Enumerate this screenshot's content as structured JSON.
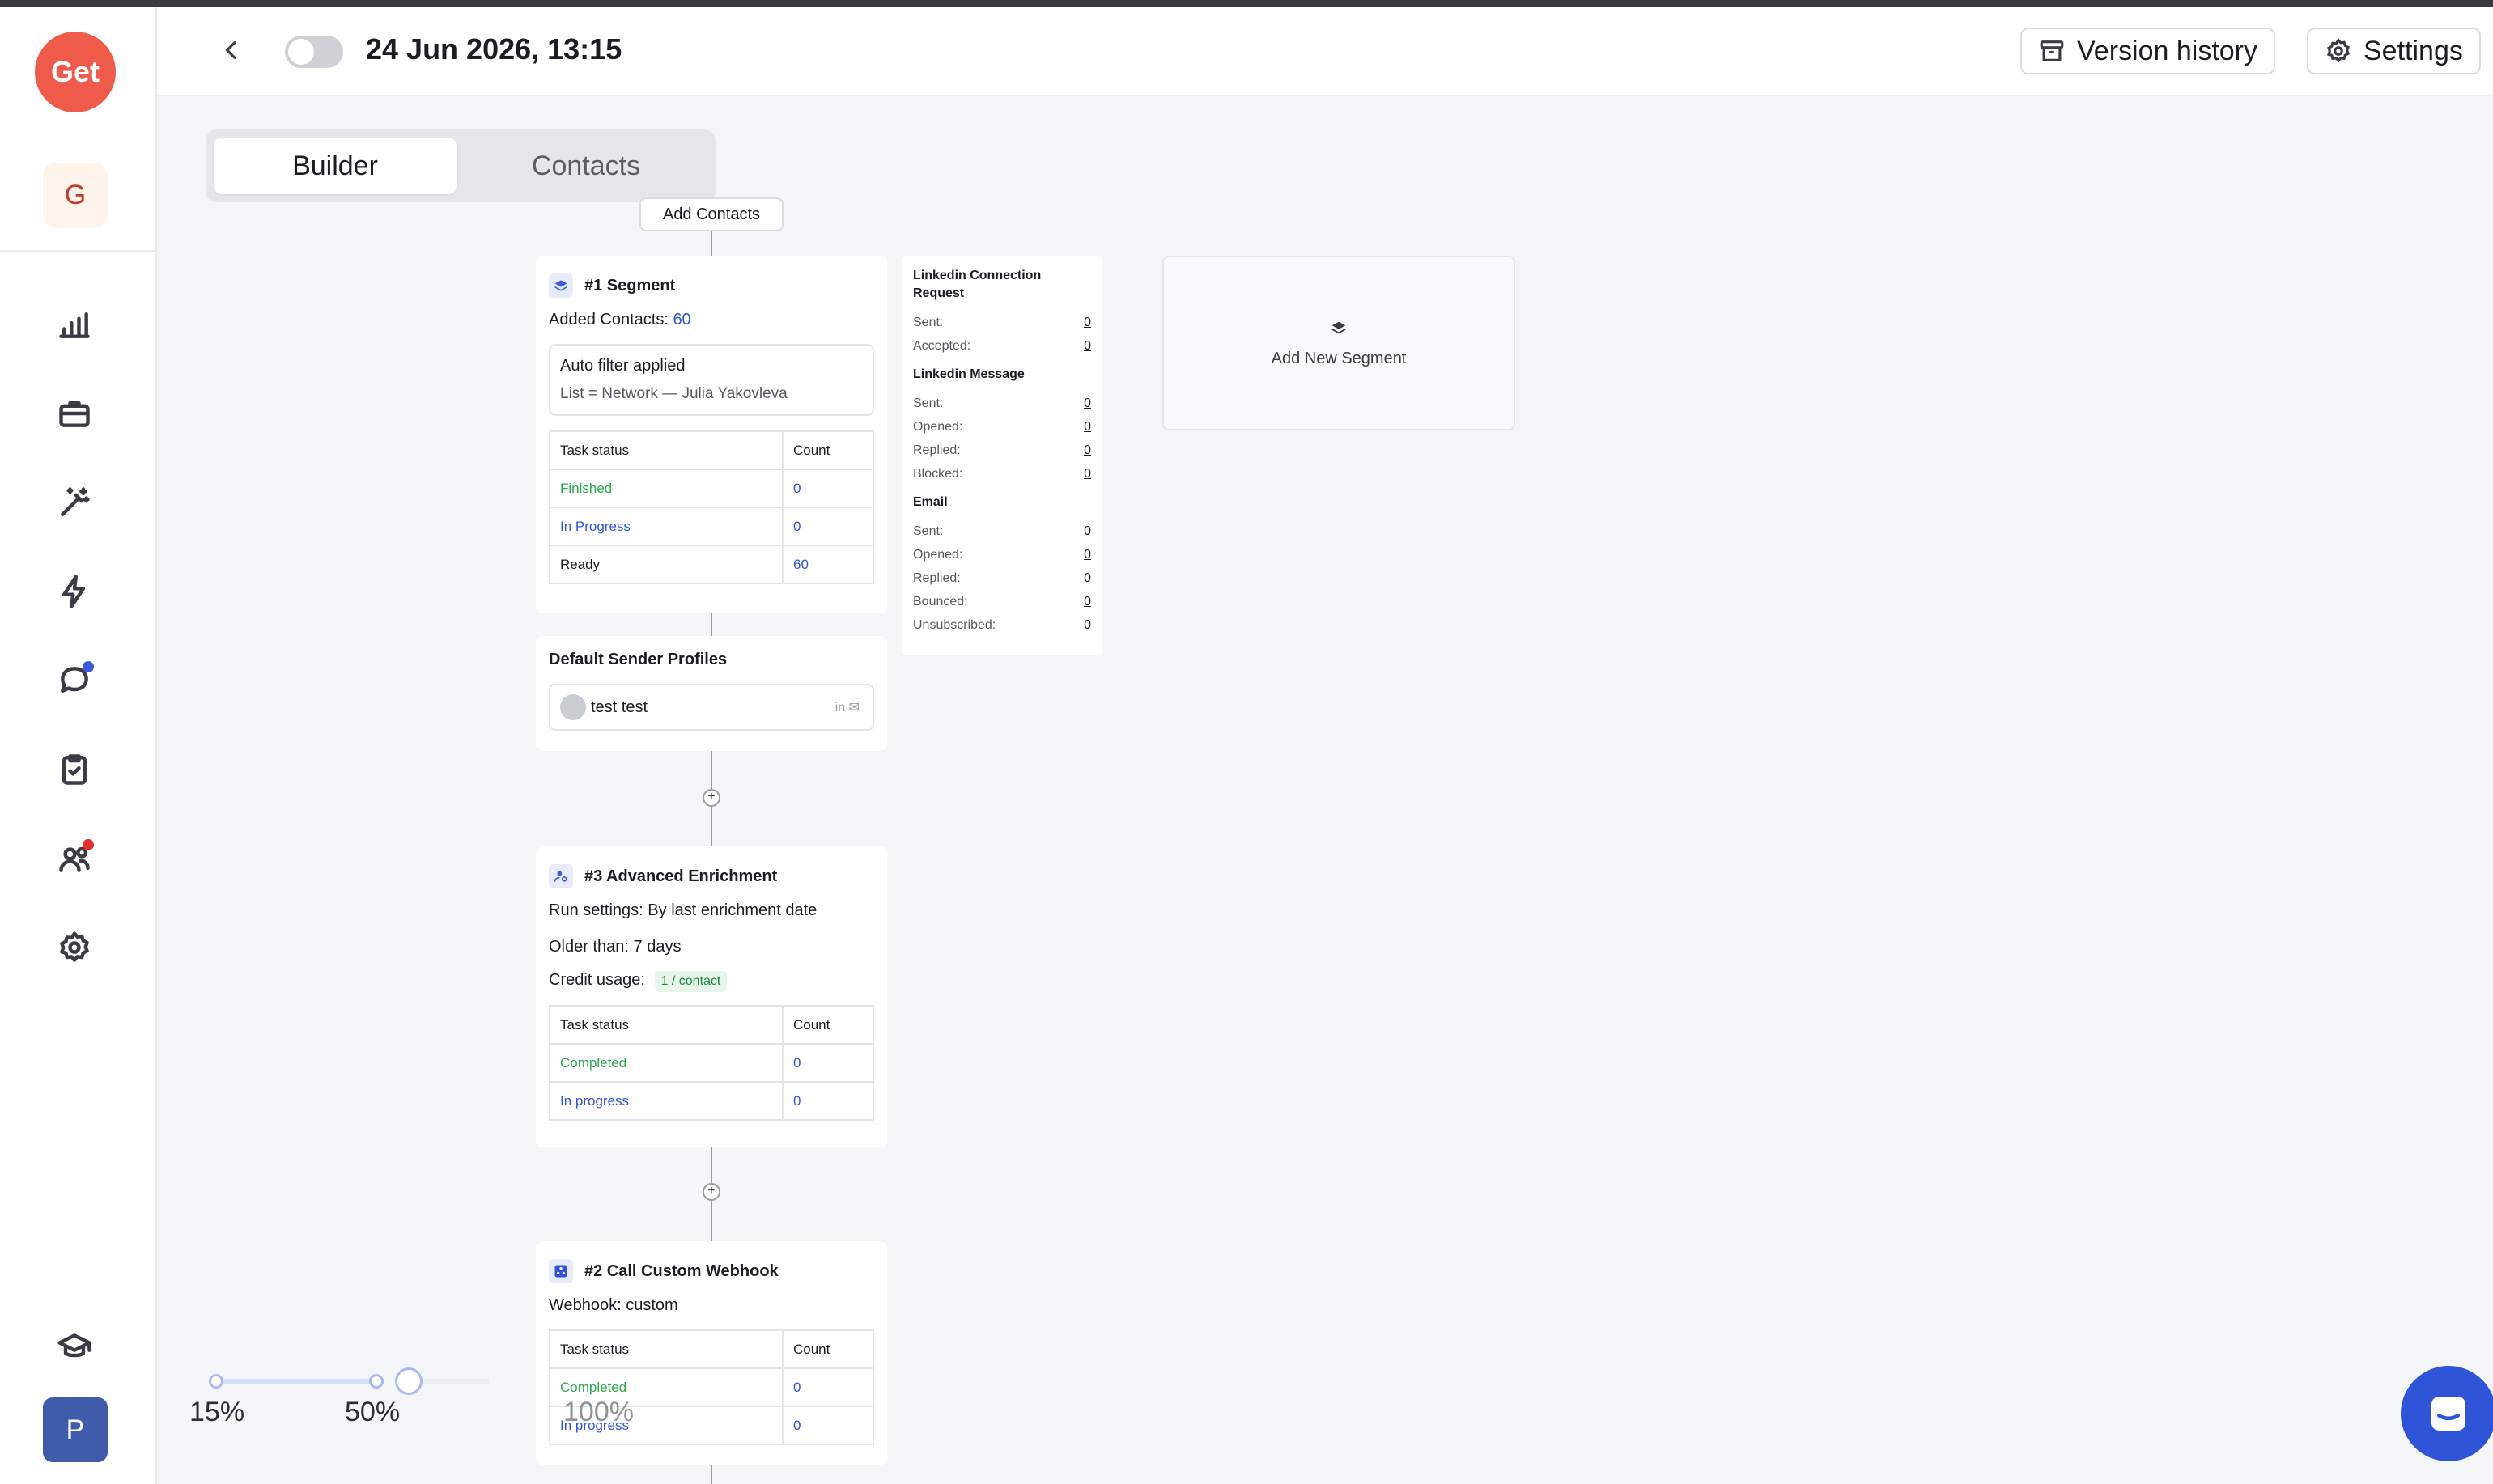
{
  "sidebar": {
    "logo": "Get",
    "workspace_initial": "G",
    "user_initial": "P",
    "nav": [
      {
        "icon": "chart-icon"
      },
      {
        "icon": "briefcase-icon"
      },
      {
        "icon": "magic-wand-icon"
      },
      {
        "icon": "lightning-icon"
      },
      {
        "icon": "chat-icon",
        "badge_color": "#3b5bdb"
      },
      {
        "icon": "clipboard-check-icon"
      },
      {
        "icon": "users-icon",
        "badge_color": "#e03131"
      },
      {
        "icon": "gear-icon"
      },
      {
        "icon": "graduation-cap-icon"
      }
    ]
  },
  "header": {
    "title": "24 Jun 2026, 13:15",
    "version_history": "Version history",
    "settings": "Settings"
  },
  "tabs": {
    "builder": "Builder",
    "contacts": "Contacts"
  },
  "flow": {
    "add_contacts": "Add Contacts",
    "segment": {
      "title": "#1 Segment",
      "added_label": "Added Contacts:",
      "added_value": "60",
      "filter_title": "Auto filter applied",
      "filter_value": "List = Network — Julia Yakovleva",
      "col_status": "Task status",
      "col_count": "Count",
      "rows": [
        {
          "status": "Finished",
          "count": "0"
        },
        {
          "status": "In Progress",
          "count": "0"
        },
        {
          "status": "Ready",
          "count": "60"
        }
      ]
    },
    "sender": {
      "title": "Default Sender Profiles",
      "name": "test test"
    },
    "enrichment": {
      "title": "#3 Advanced Enrichment",
      "run_label": "Run settings:",
      "run_value": "By last enrichment date",
      "older_label": "Older than:",
      "older_value": "7 days",
      "credit_label": "Credit usage:",
      "credit_value": "1 / contact",
      "col_status": "Task status",
      "col_count": "Count",
      "rows": [
        {
          "status": "Completed",
          "count": "0"
        },
        {
          "status": "In progress",
          "count": "0"
        }
      ]
    },
    "webhook": {
      "title": "#2 Call Custom Webhook",
      "webhook_label": "Webhook:",
      "webhook_value": "custom",
      "col_status": "Task status",
      "col_count": "Count",
      "rows": [
        {
          "status": "Completed",
          "count": "0"
        },
        {
          "status": "In progress",
          "count": "0"
        }
      ]
    }
  },
  "stats": {
    "linkedin_connection": {
      "title": "Linkedin Connection Request",
      "sent_label": "Sent:",
      "sent": "0",
      "accepted_label": "Accepted:",
      "accepted": "0"
    },
    "linkedin_message": {
      "title": "Linkedin Message",
      "sent_label": "Sent:",
      "sent": "0",
      "opened_label": "Opened:",
      "opened": "0",
      "replied_label": "Replied:",
      "replied": "0",
      "blocked_label": "Blocked:",
      "blocked": "0"
    },
    "email": {
      "title": "Email",
      "sent_label": "Sent:",
      "sent": "0",
      "opened_label": "Opened:",
      "opened": "0",
      "replied_label": "Replied:",
      "replied": "0",
      "bounced_label": "Bounced:",
      "bounced": "0",
      "unsubscribed_label": "Unsubscribed:",
      "unsubscribed": "0"
    }
  },
  "add_segment": "Add New Segment",
  "zoom": {
    "labels": [
      "15%",
      "50%",
      "100%"
    ],
    "current_percent": 50
  },
  "colors": {
    "brand": "#ef5b4a",
    "accent": "#2f54d8",
    "success": "#2aa84a"
  }
}
